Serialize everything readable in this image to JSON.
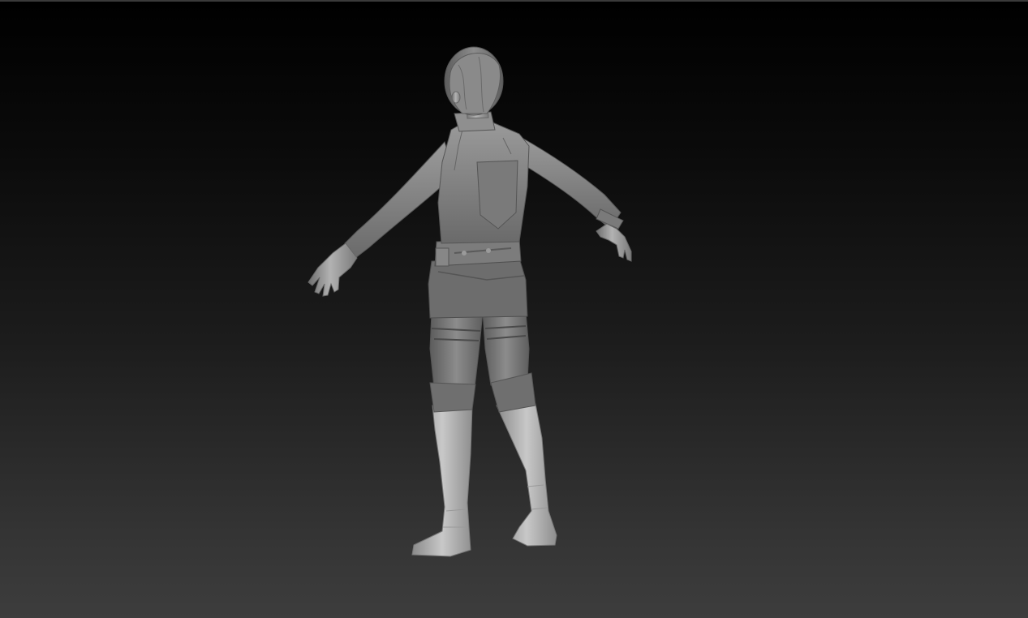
{
  "viewport": {
    "background_top": "#000000",
    "background_bottom": "#3d3d3d"
  },
  "model": {
    "material_color": "#8a8a8a",
    "icon": "sculpt-figure-back-view"
  }
}
